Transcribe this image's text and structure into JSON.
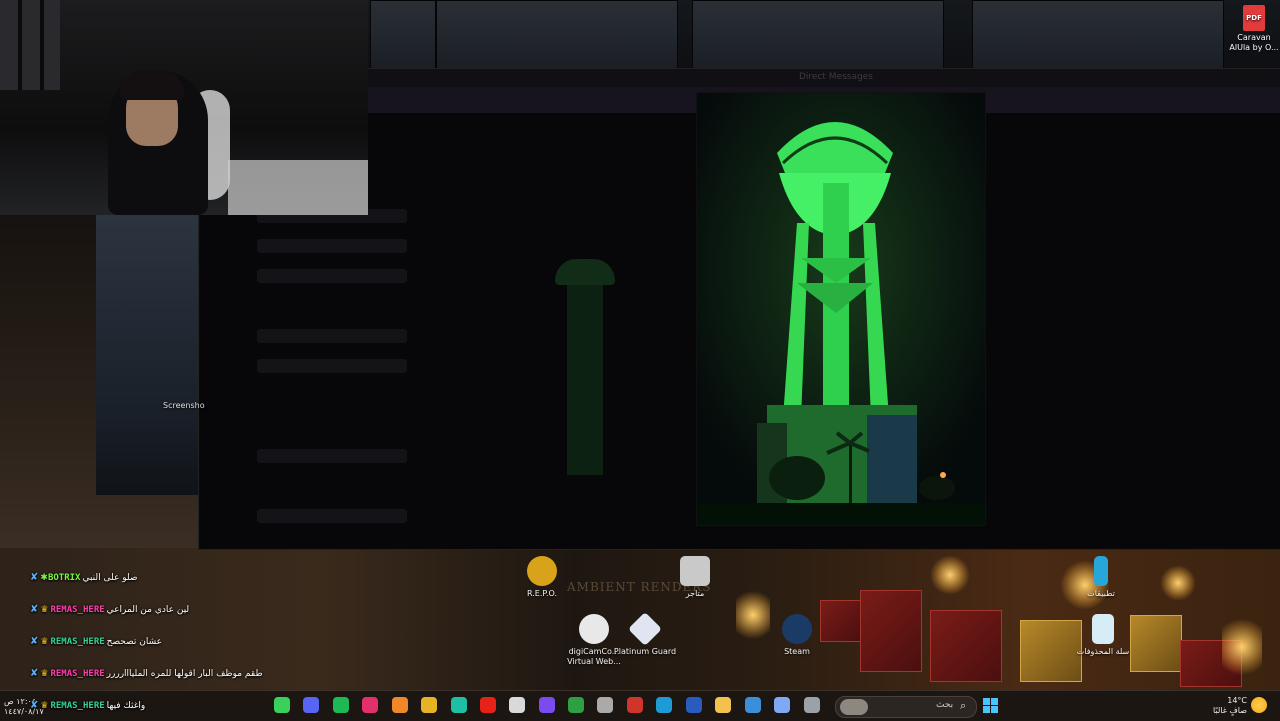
{
  "desktop": {
    "pdf_file": {
      "badge": "PDF",
      "label_line1": "Caravan",
      "label_line2": "AlUla by O..."
    },
    "screenshot_label": "Screensho",
    "ambient_text": "AMBIENT RENDERS",
    "icons": [
      {
        "name": "repo",
        "label": "R.E.P.O.",
        "color": "#d9a21b"
      },
      {
        "name": "store",
        "label": "متاجر",
        "color": "#c9c9c9"
      },
      {
        "name": "apps",
        "label": "تطبيقات",
        "color": "#27a7d9"
      },
      {
        "name": "digicam",
        "label": "digiCamCo... Virtual Web...",
        "color": "#e8e8e8"
      },
      {
        "name": "platinum-guard",
        "label": "Platinum Guard",
        "color": "#dfe6f2"
      },
      {
        "name": "steam",
        "label": "Steam",
        "color": "#1b3b67"
      },
      {
        "name": "recycle-bin",
        "label": "سلة المحذوفات",
        "color": "#d6ecf7"
      }
    ]
  },
  "dim_app": {
    "title": "Direct Messages"
  },
  "chat": [
    {
      "user": "BOTRIX",
      "badge": "sword",
      "crown": false,
      "user_color": "#7cf542",
      "message": "صلو على النبي"
    },
    {
      "user": "REMAS_HERE",
      "badge": "sword",
      "crown": true,
      "user_color": "#ff3fae",
      "message": "لين عادي من المراعي"
    },
    {
      "user": "REMAS_HERE",
      "badge": "sword",
      "crown": true,
      "user_color": "#34d399",
      "message": "عشان تصحصح"
    },
    {
      "user": "REMAS_HERE",
      "badge": "sword",
      "crown": true,
      "user_color": "#ff3fae",
      "message": "طقم موظف البار اقولها للمره المليااارررر"
    },
    {
      "user": "REMAS_HERE",
      "badge": "sword",
      "crown": true,
      "user_color": "#34d399",
      "message": "واغثك فيها"
    }
  ],
  "taskbar": {
    "clock_time": "١٢:٠٤ ص",
    "clock_date": "١٤٤٧/٠٨/١٧",
    "search_placeholder": "بحث",
    "weather_temp": "14°C",
    "weather_desc": "صافٍ غالبًا",
    "apps": [
      {
        "name": "arrow-app-icon",
        "color": "#3ad15b"
      },
      {
        "name": "discord-icon",
        "color": "#5865f2"
      },
      {
        "name": "spotify-icon",
        "color": "#1db954"
      },
      {
        "name": "instagram-icon",
        "color": "#e1306c"
      },
      {
        "name": "a-app-icon",
        "color": "#f0882a"
      },
      {
        "name": "chrome-icon",
        "color": "#e6b325"
      },
      {
        "name": "teal-app-icon",
        "color": "#1fbfa4"
      },
      {
        "name": "youtube-icon",
        "color": "#e62117"
      },
      {
        "name": "obs-icon",
        "color": "#d9d9d9"
      },
      {
        "name": "photo-icon",
        "color": "#7a4cf0"
      },
      {
        "name": "xbox-icon",
        "color": "#2ea043"
      },
      {
        "name": "epic-icon",
        "color": "#aaaaaa"
      },
      {
        "name": "red-app-icon",
        "color": "#d0342c"
      },
      {
        "name": "edge-icon",
        "color": "#1c9bd6"
      },
      {
        "name": "playstation-icon",
        "color": "#2a5cbf"
      },
      {
        "name": "folder-icon",
        "color": "#f2c14e"
      },
      {
        "name": "store-icon",
        "color": "#3b8fd9"
      },
      {
        "name": "copilot-icon",
        "color": "#7fa8f5"
      },
      {
        "name": "window-icon",
        "color": "#9aa1a8"
      }
    ]
  }
}
